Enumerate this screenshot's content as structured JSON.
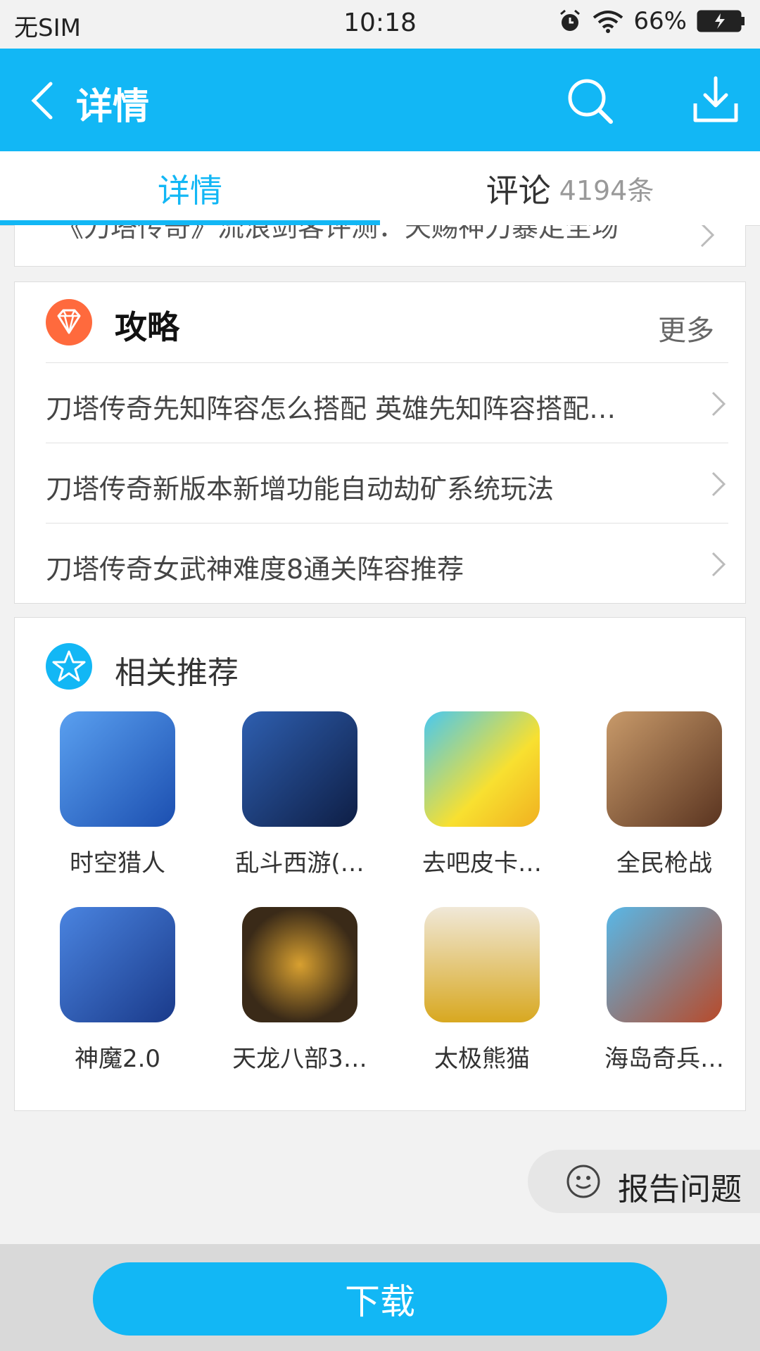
{
  "status_bar": {
    "carrier": "无SIM",
    "time": "10:18",
    "battery": "66%"
  },
  "header": {
    "title": "详情"
  },
  "tabs": {
    "detail": "详情",
    "reviews": "评论",
    "reviews_count": "4194条"
  },
  "partial_item": "《刀塔传奇》流浪剑客评测：天赐神刀暴走全场",
  "guide": {
    "title": "攻略",
    "more": "更多",
    "items": [
      "刀塔传奇先知阵容怎么搭配 英雄先知阵容搭配…",
      "刀塔传奇新版本新增功能自动劫矿系统玩法",
      "刀塔传奇女武神难度8通关阵容推荐"
    ]
  },
  "recommendations": {
    "title": "相关推荐",
    "apps": [
      {
        "name": "时空猎人",
        "color": "#3a78d8"
      },
      {
        "name": "乱斗西游(…",
        "color": "#1f3a7a"
      },
      {
        "name": "去吧皮卡…",
        "color": "#f6d21a"
      },
      {
        "name": "全民枪战",
        "color": "#8a5a3a"
      },
      {
        "name": "神魔2.0",
        "color": "#2a5ab0"
      },
      {
        "name": "天龙八部3…",
        "color": "#3a3a3a"
      },
      {
        "name": "太极熊猫",
        "color": "#d8a820"
      },
      {
        "name": "海岛奇兵…",
        "color": "#3aa0d8"
      }
    ]
  },
  "report": {
    "label": "报告问题"
  },
  "download_button": "下载",
  "colors": {
    "accent": "#12b7f5",
    "guide_icon": "#ff6a3d"
  }
}
